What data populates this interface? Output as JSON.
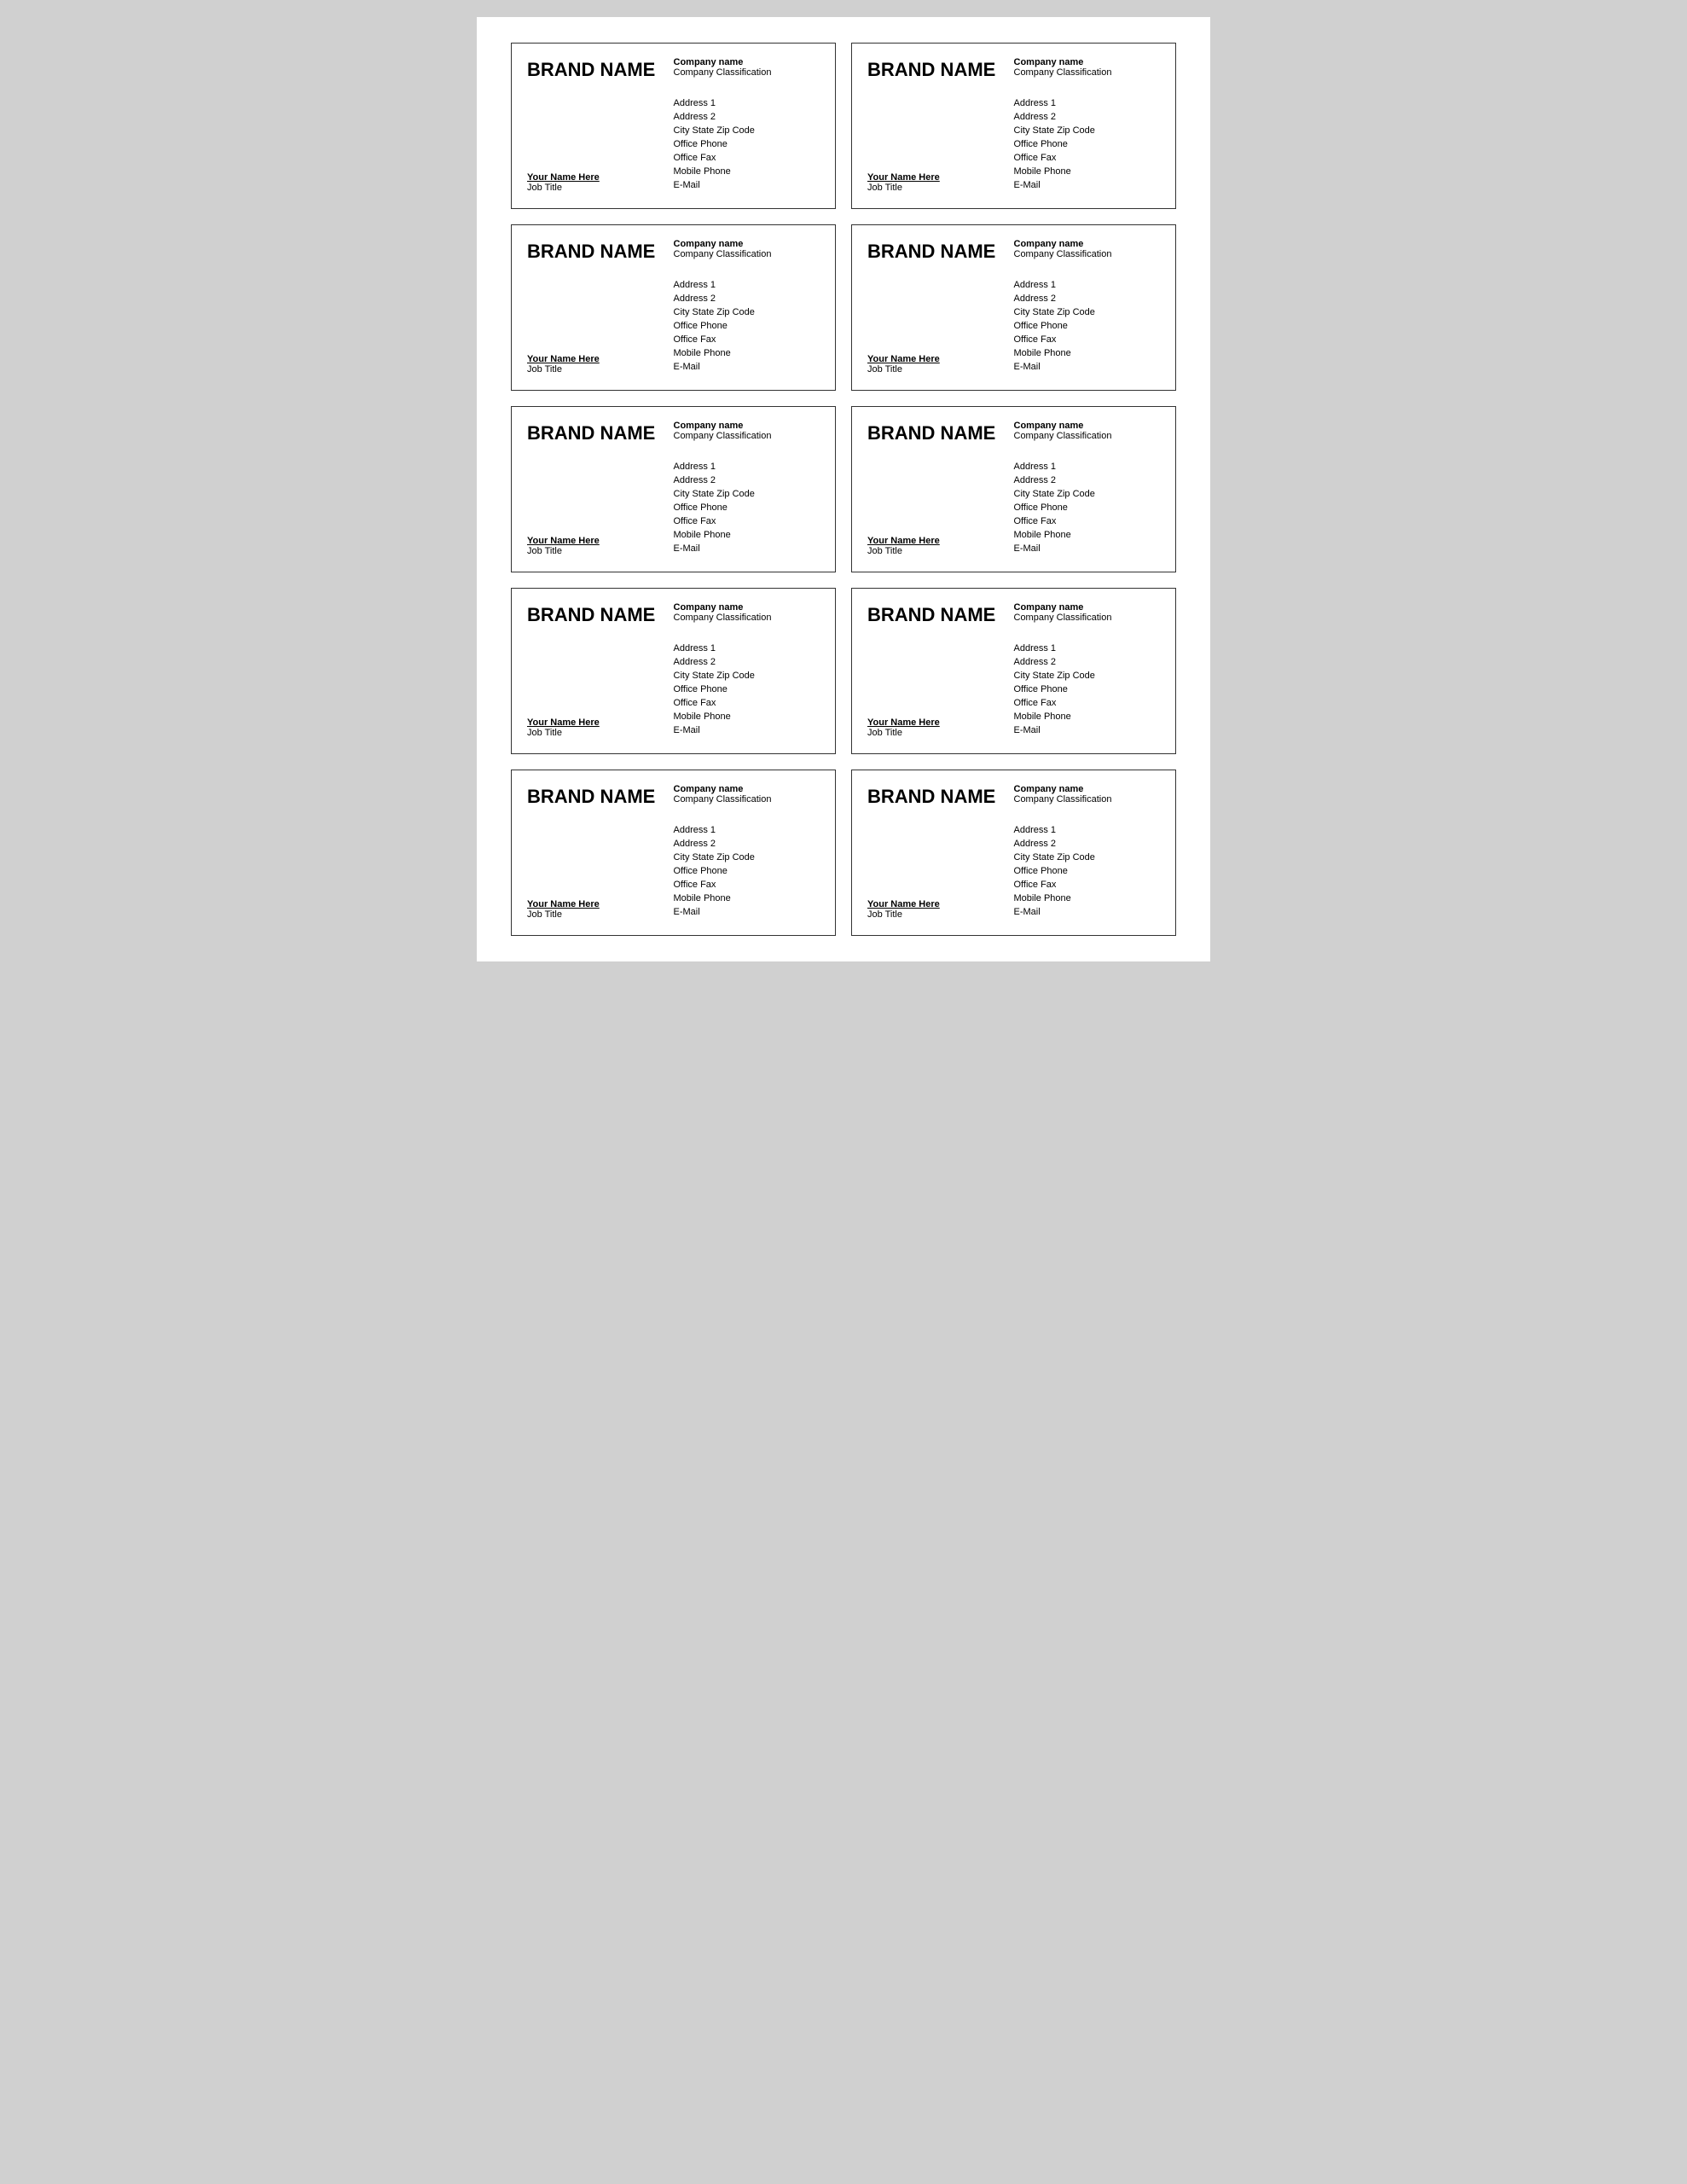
{
  "cards": [
    {
      "brand": "BRAND NAME",
      "companyName": "Company name",
      "companyClassification": "Company Classification",
      "yourName": "Your Name Here",
      "jobTitle": "Job Title",
      "address": [
        "Address 1",
        "Address 2",
        "City State Zip Code",
        "Office Phone",
        "Office Fax",
        "Mobile Phone",
        "E-Mail"
      ]
    },
    {
      "brand": "BRAND NAME",
      "companyName": "Company name",
      "companyClassification": "Company Classification",
      "yourName": "Your Name Here",
      "jobTitle": "Job Title",
      "address": [
        "Address 1",
        "Address 2",
        "City State Zip Code",
        "Office Phone",
        "Office Fax",
        "Mobile Phone",
        "E-Mail"
      ]
    },
    {
      "brand": "BRAND NAME",
      "companyName": "Company name",
      "companyClassification": "Company Classification",
      "yourName": "Your Name Here",
      "jobTitle": "Job Title",
      "address": [
        "Address 1",
        "Address 2",
        "City State Zip Code",
        "Office Phone",
        "Office Fax",
        "Mobile Phone",
        "E-Mail"
      ]
    },
    {
      "brand": "BRAND NAME",
      "companyName": "Company name",
      "companyClassification": "Company Classification",
      "yourName": "Your Name Here",
      "jobTitle": "Job Title",
      "address": [
        "Address 1",
        "Address 2",
        "City State Zip Code",
        "Office Phone",
        "Office Fax",
        "Mobile Phone",
        "E-Mail"
      ]
    },
    {
      "brand": "BRAND NAME",
      "companyName": "Company name",
      "companyClassification": "Company Classification",
      "yourName": "Your Name Here",
      "jobTitle": "Job Title",
      "address": [
        "Address 1",
        "Address 2",
        "City State Zip Code",
        "Office Phone",
        "Office Fax",
        "Mobile Phone",
        "E-Mail"
      ]
    },
    {
      "brand": "BRAND NAME",
      "companyName": "Company name",
      "companyClassification": "Company Classification",
      "yourName": "Your Name Here",
      "jobTitle": "Job Title",
      "address": [
        "Address 1",
        "Address 2",
        "City State Zip Code",
        "Office Phone",
        "Office Fax",
        "Mobile Phone",
        "E-Mail"
      ]
    },
    {
      "brand": "BRAND NAME",
      "companyName": "Company name",
      "companyClassification": "Company Classification",
      "yourName": "Your Name Here",
      "jobTitle": "Job Title",
      "address": [
        "Address 1",
        "Address 2",
        "City State Zip Code",
        "Office Phone",
        "Office Fax",
        "Mobile Phone",
        "E-Mail"
      ]
    },
    {
      "brand": "BRAND NAME",
      "companyName": "Company name",
      "companyClassification": "Company Classification",
      "yourName": "Your Name Here",
      "jobTitle": "Job Title",
      "address": [
        "Address 1",
        "Address 2",
        "City State Zip Code",
        "Office Phone",
        "Office Fax",
        "Mobile Phone",
        "E-Mail"
      ]
    },
    {
      "brand": "BRAND NAME",
      "companyName": "Company name",
      "companyClassification": "Company Classification",
      "yourName": "Your Name Here",
      "jobTitle": "Job Title",
      "address": [
        "Address 1",
        "Address 2",
        "City State Zip Code",
        "Office Phone",
        "Office Fax",
        "Mobile Phone",
        "E-Mail"
      ]
    },
    {
      "brand": "BRAND NAME",
      "companyName": "Company name",
      "companyClassification": "Company Classification",
      "yourName": "Your Name Here",
      "jobTitle": "Job Title",
      "address": [
        "Address 1",
        "Address 2",
        "City State Zip Code",
        "Office Phone",
        "Office Fax",
        "Mobile Phone",
        "E-Mail"
      ]
    }
  ]
}
